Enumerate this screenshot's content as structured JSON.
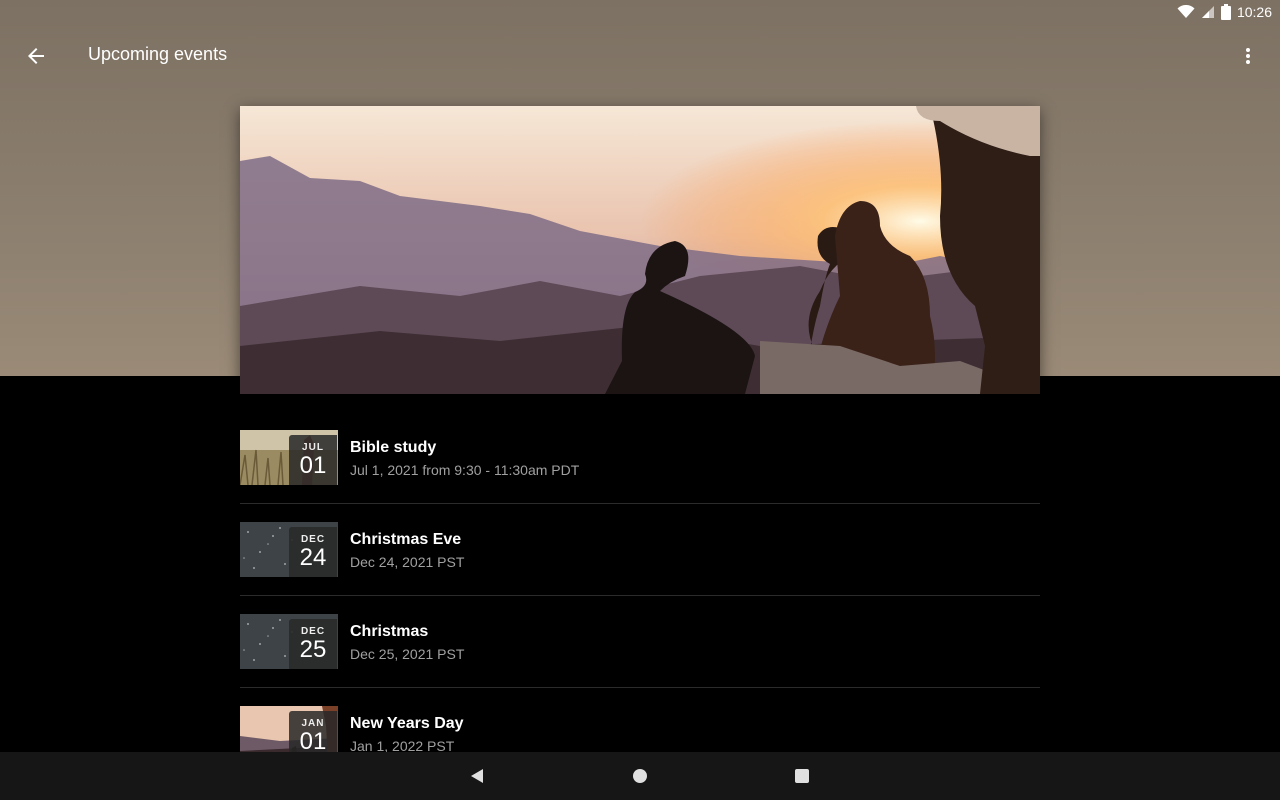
{
  "status_bar": {
    "time": "10:26",
    "icons": [
      "wifi-icon",
      "signal-icon",
      "battery-icon"
    ]
  },
  "app_bar": {
    "title": "Upcoming events",
    "back_icon": "back-arrow-icon",
    "menu_icon": "more-vert-icon"
  },
  "hero": {
    "image": "sunset-mountain-photo"
  },
  "events": [
    {
      "month": "JUL",
      "day": "01",
      "title": "Bible study",
      "date": "Jul 1, 2021 from 9:30 - 11:30am PDT",
      "thumb": "grass-field-photo"
    },
    {
      "month": "DEC",
      "day": "24",
      "title": "Christmas Eve",
      "date": "Dec 24, 2021 PST",
      "thumb": "snow-night-photo"
    },
    {
      "month": "DEC",
      "day": "25",
      "title": "Christmas",
      "date": "Dec 25, 2021 PST",
      "thumb": "snow-night-photo"
    },
    {
      "month": "JAN",
      "day": "01",
      "title": "New Years Day",
      "date": "Jan 1, 2022 PST",
      "thumb": "sunset-photo"
    }
  ],
  "nav_bar": {
    "icons": [
      "nav-back-icon",
      "nav-home-icon",
      "nav-recents-icon"
    ]
  },
  "colors": {
    "background": "#000000",
    "header_bg": "#857868",
    "divider": "#2b2b2b",
    "secondary_text": "#a0a0a0",
    "nav_bg": "#161616"
  }
}
